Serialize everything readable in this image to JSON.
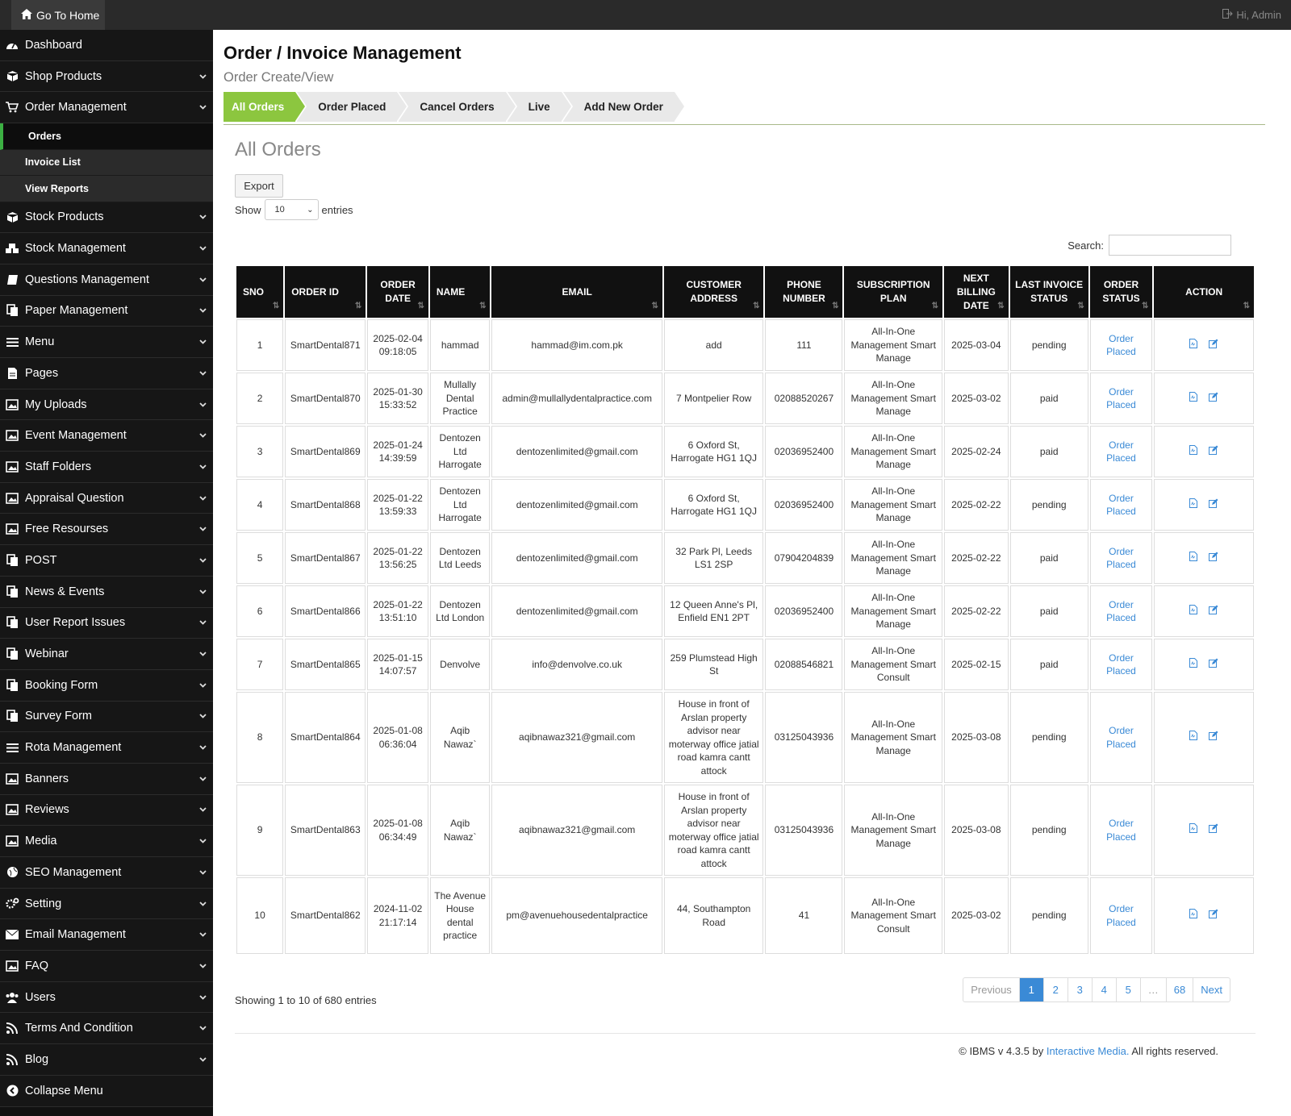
{
  "topbar": {
    "home_label": "Go To Home",
    "user_label": "Hi, Admin"
  },
  "sidebar": {
    "items": [
      {
        "label": "Dashboard",
        "icon": "dashboard-icon",
        "chevron": false
      },
      {
        "label": "Shop Products",
        "icon": "box-icon",
        "chevron": true
      },
      {
        "label": "Order Management",
        "icon": "cart-icon",
        "chevron": true
      },
      {
        "label": "Stock Products",
        "icon": "box-icon",
        "chevron": true
      },
      {
        "label": "Stock Management",
        "icon": "cubes-icon",
        "chevron": true
      },
      {
        "label": "Questions Management",
        "icon": "book-icon",
        "chevron": true
      },
      {
        "label": "Paper Management",
        "icon": "copy-icon",
        "chevron": true
      },
      {
        "label": "Menu",
        "icon": "bars-icon",
        "chevron": true
      },
      {
        "label": "Pages",
        "icon": "file-icon",
        "chevron": true
      },
      {
        "label": "My Uploads",
        "icon": "image-icon",
        "chevron": true
      },
      {
        "label": "Event Management",
        "icon": "image-icon",
        "chevron": true
      },
      {
        "label": "Staff Folders",
        "icon": "image-icon",
        "chevron": true
      },
      {
        "label": "Appraisal Question",
        "icon": "image-icon",
        "chevron": true
      },
      {
        "label": "Free Resourses",
        "icon": "image-icon",
        "chevron": true
      },
      {
        "label": "POST",
        "icon": "copy-icon",
        "chevron": true
      },
      {
        "label": "News & Events",
        "icon": "copy-icon",
        "chevron": true
      },
      {
        "label": "User Report Issues",
        "icon": "copy-icon",
        "chevron": true
      },
      {
        "label": "Webinar",
        "icon": "copy-icon",
        "chevron": true
      },
      {
        "label": "Booking Form",
        "icon": "copy-icon",
        "chevron": true
      },
      {
        "label": "Survey Form",
        "icon": "copy-icon",
        "chevron": true
      },
      {
        "label": "Rota Management",
        "icon": "bars-icon",
        "chevron": true
      },
      {
        "label": "Banners",
        "icon": "image-icon",
        "chevron": true
      },
      {
        "label": "Reviews",
        "icon": "image-icon",
        "chevron": true
      },
      {
        "label": "Media",
        "icon": "image-icon",
        "chevron": true
      },
      {
        "label": "SEO Management",
        "icon": "globe-icon",
        "chevron": true
      },
      {
        "label": "Setting",
        "icon": "gears-icon",
        "chevron": true
      },
      {
        "label": "Email Management",
        "icon": "envelope-icon",
        "chevron": true
      },
      {
        "label": "FAQ",
        "icon": "image-icon",
        "chevron": true
      },
      {
        "label": "Users",
        "icon": "users-icon",
        "chevron": true
      },
      {
        "label": "Terms And Condition",
        "icon": "rss-icon",
        "chevron": true
      },
      {
        "label": "Blog",
        "icon": "rss-icon",
        "chevron": true
      },
      {
        "label": "Collapse Menu",
        "icon": "collapse-icon",
        "chevron": false
      }
    ],
    "order_submenu": [
      {
        "label": "Orders",
        "active": true
      },
      {
        "label": "Invoice List",
        "active": false
      },
      {
        "label": "View Reports",
        "active": false
      }
    ]
  },
  "header": {
    "title": "Order / Invoice Management",
    "subtitle": "Order Create/View"
  },
  "steps": [
    "All Orders",
    "Order Placed",
    "Cancel Orders",
    "Live",
    "Add New Order"
  ],
  "section": {
    "title": "All Orders",
    "export_label": "Export",
    "show_label": "Show",
    "show_value": "10",
    "entries_label": "entries",
    "search_label": "Search:"
  },
  "table": {
    "columns": [
      "SNO",
      "ORDER ID",
      "ORDER DATE",
      "NAME",
      "EMAIL",
      "CUSTOMER ADDRESS",
      "PHONE NUMBER",
      "SUBSCRIPTION PLAN",
      "NEXT BILLING DATE",
      "LAST INVOICE STATUS",
      "ORDER STATUS",
      "ACTION"
    ],
    "rows": [
      [
        "1",
        "SmartDental871",
        "2025-02-04 09:18:05",
        "hammad",
        "hammad@im.com.pk",
        "add",
        "111",
        "All-In-One Management Smart Manage",
        "2025-03-04",
        "pending",
        "Order Placed"
      ],
      [
        "2",
        "SmartDental870",
        "2025-01-30 15:33:52",
        "Mullally Dental Practice",
        "admin@mullallydentalpractice.com",
        "7 Montpelier Row",
        "02088520267",
        "All-In-One Management Smart Manage",
        "2025-03-02",
        "paid",
        "Order Placed"
      ],
      [
        "3",
        "SmartDental869",
        "2025-01-24 14:39:59",
        "Dentozen Ltd Harrogate",
        "dentozenlimited@gmail.com",
        "6 Oxford St, Harrogate HG1 1QJ",
        "02036952400",
        "All-In-One Management Smart Manage",
        "2025-02-24",
        "paid",
        "Order Placed"
      ],
      [
        "4",
        "SmartDental868",
        "2025-01-22 13:59:33",
        "Dentozen Ltd Harrogate",
        "dentozenlimited@gmail.com",
        "6 Oxford St, Harrogate HG1 1QJ",
        "02036952400",
        "All-In-One Management Smart Manage",
        "2025-02-22",
        "pending",
        "Order Placed"
      ],
      [
        "5",
        "SmartDental867",
        "2025-01-22 13:56:25",
        "Dentozen Ltd Leeds",
        "dentozenlimited@gmail.com",
        "32 Park Pl, Leeds LS1 2SP",
        "07904204839",
        "All-In-One Management Smart Manage",
        "2025-02-22",
        "paid",
        "Order Placed"
      ],
      [
        "6",
        "SmartDental866",
        "2025-01-22 13:51:10",
        "Dentozen Ltd London",
        "dentozenlimited@gmail.com",
        "12 Queen Anne's Pl, Enfield EN1 2PT",
        "02036952400",
        "All-In-One Management Smart Manage",
        "2025-02-22",
        "paid",
        "Order Placed"
      ],
      [
        "7",
        "SmartDental865",
        "2025-01-15 14:07:57",
        "Denvolve",
        "info@denvolve.co.uk",
        "259 Plumstead High St",
        "02088546821",
        "All-In-One Management Smart Consult",
        "2025-02-15",
        "paid",
        "Order Placed"
      ],
      [
        "8",
        "SmartDental864",
        "2025-01-08 06:36:04",
        "Aqib Nawaz`",
        "aqibnawaz321@gmail.com",
        "House in front of Arslan property advisor near moterway office jatial road kamra cantt attock",
        "03125043936",
        "All-In-One Management Smart Manage",
        "2025-03-08",
        "pending",
        "Order Placed"
      ],
      [
        "9",
        "SmartDental863",
        "2025-01-08 06:34:49",
        "Aqib Nawaz`",
        "aqibnawaz321@gmail.com",
        "House in front of Arslan property advisor near moterway office jatial road kamra cantt attock",
        "03125043936",
        "All-In-One Management Smart Manage",
        "2025-03-08",
        "pending",
        "Order Placed"
      ],
      [
        "10",
        "SmartDental862",
        "2024-11-02 21:17:14",
        "The Avenue House dental practice",
        "pm@avenuehousedentalpractice",
        "44, Southampton Road",
        "41",
        "All-In-One Management Smart Consult",
        "2025-03-02",
        "pending",
        "Order Placed"
      ]
    ]
  },
  "pagination": {
    "info": "Showing 1 to 10 of 680 entries",
    "items": [
      "Previous",
      "1",
      "2",
      "3",
      "4",
      "5",
      "…",
      "68",
      "Next"
    ],
    "active": "1"
  },
  "footer": {
    "prefix": "© IBMS v 4.3.5 by",
    "brand": "Interactive Media.",
    "suffix": "All rights reserved."
  },
  "colors": {
    "accent_green": "#8cc63f",
    "link_blue": "#3a8ad6",
    "sidebar_bg": "#111111"
  }
}
